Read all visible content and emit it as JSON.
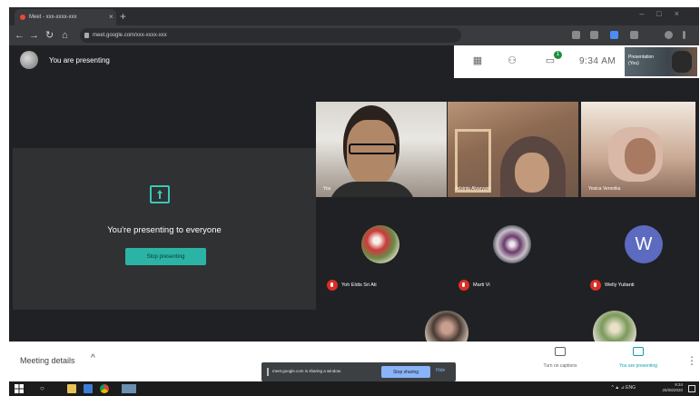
{
  "browser": {
    "tab_title": "Meet - xxx-xxxx-xxx",
    "tab_close": "×",
    "new_tab": "+",
    "back": "←",
    "forward": "→",
    "reload": "↻",
    "home": "⌂",
    "url": "meet.google.com/xxx-xxxx-xxx",
    "window_controls": "–□×"
  },
  "meet_header": {
    "title": "You are presenting",
    "clock": "9:34 AM",
    "self_label_line1": "Presentation",
    "self_label_line2": "(You)",
    "chat_badge": "1"
  },
  "presentation": {
    "message": "You're presenting to everyone",
    "stop_button": "Stop presenting"
  },
  "video_tiles": [
    {
      "name": "You"
    },
    {
      "name": "Jelsinta Alvaryani"
    },
    {
      "name": "Yesica Veronika"
    }
  ],
  "participants": [
    {
      "name": "Yoh Eldis Sri Ati",
      "avatar": "photo",
      "muted": true
    },
    {
      "name": "Marti Vi",
      "avatar": "photo",
      "muted": true
    },
    {
      "name": "Welly Yulianti",
      "avatar": "letter",
      "initial": "W",
      "muted": true
    }
  ],
  "controls": {
    "meeting_details": "Meeting details",
    "meeting_details_chevron": "^",
    "captions_label": "Turn on captions",
    "present_label": "You are presenting",
    "more": "⋮"
  },
  "share_bar": {
    "message": "meet.google.com is sharing a window.",
    "stop_button": "Stop sharing",
    "hide": "Hide"
  },
  "taskbar": {
    "search_glyph": "○",
    "tray_text": "^ ▲ ⊿ ENG",
    "time": "9:34",
    "date": "25/08/2020"
  },
  "colors": {
    "accent_teal": "#2bb3a5",
    "meet_dark": "#202124",
    "mute_red": "#d93025",
    "avatar_w": "#5c6bc0"
  }
}
